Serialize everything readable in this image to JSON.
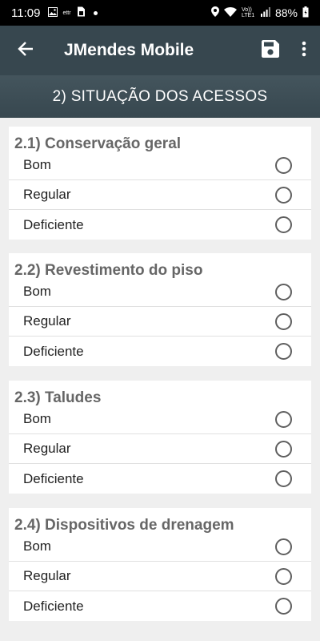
{
  "status_bar": {
    "time": "11:09",
    "carrier_tag": "ettr",
    "network": "Vo)) LTE1",
    "battery": "88%",
    "icons": [
      "image-icon",
      "sim-icon",
      "location-icon",
      "wifi-icon",
      "signal-icon",
      "battery-icon"
    ]
  },
  "app_bar": {
    "title": "JMendes Mobile",
    "icons": [
      "back-arrow-icon",
      "save-icon",
      "more-vert-icon"
    ]
  },
  "section": {
    "title": "2) SITUAÇÃO DOS ACESSOS"
  },
  "questions": [
    {
      "title": "2.1) Conservação geral",
      "options": [
        {
          "label": "Bom",
          "selected": false
        },
        {
          "label": "Regular",
          "selected": false
        },
        {
          "label": "Deficiente",
          "selected": false
        }
      ]
    },
    {
      "title": "2.2) Revestimento do piso",
      "options": [
        {
          "label": "Bom",
          "selected": false
        },
        {
          "label": "Regular",
          "selected": false
        },
        {
          "label": "Deficiente",
          "selected": false
        }
      ]
    },
    {
      "title": "2.3) Taludes",
      "options": [
        {
          "label": "Bom",
          "selected": false
        },
        {
          "label": "Regular",
          "selected": false
        },
        {
          "label": "Deficiente",
          "selected": false
        }
      ]
    },
    {
      "title": "2.4) Dispositivos de drenagem",
      "options": [
        {
          "label": "Bom",
          "selected": false
        },
        {
          "label": "Regular",
          "selected": false
        },
        {
          "label": "Deficiente",
          "selected": false
        }
      ]
    }
  ],
  "colors": {
    "app_bar": "#37474f",
    "status_bar": "#000000",
    "background": "#efefef",
    "card_title": "#666666",
    "radio_border": "#5f5f5f"
  }
}
